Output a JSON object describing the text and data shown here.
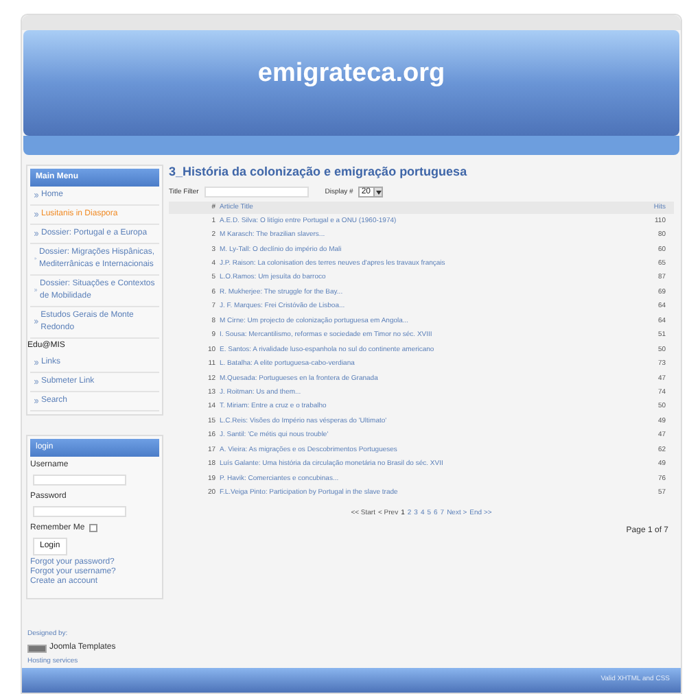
{
  "site_title": "emigrateca.org",
  "main_menu": {
    "title": "Main Menu",
    "items": [
      {
        "label": "Home",
        "kind": "link",
        "selected": false
      },
      {
        "label": "Lusitanis in Diaspora",
        "kind": "link",
        "selected": true
      },
      {
        "label": "Dossier: Portugal e a Europa",
        "kind": "link",
        "selected": false
      },
      {
        "label": "Dossier: Migrações Hispânicas, Mediterrânicas e Internacionais",
        "kind": "link",
        "selected": false
      },
      {
        "label": "Dossier: Situações e Contextos de Mobilidade",
        "kind": "link",
        "selected": false
      },
      {
        "label": "Estudos Gerais de Monte Redondo",
        "kind": "link",
        "selected": false
      },
      {
        "label": "Edu@MIS",
        "kind": "heading"
      },
      {
        "label": "Links",
        "kind": "link",
        "selected": false
      },
      {
        "label": "Submeter Link",
        "kind": "link",
        "selected": false
      },
      {
        "label": "Search",
        "kind": "link",
        "selected": false
      }
    ]
  },
  "login": {
    "title": "login",
    "username_label": "Username",
    "password_label": "Password",
    "remember_label": "Remember Me",
    "remember_checked": false,
    "button": "Login",
    "links": [
      "Forgot your password?",
      "Forgot your username?",
      "Create an account"
    ]
  },
  "credits": {
    "designed_by": "Designed by:",
    "templates": "Joomla Templates",
    "hosting": "Hosting services"
  },
  "content": {
    "heading": "3_História da colonização e emigração portuguesa",
    "filter_label": "Title Filter",
    "display_label": "Display #",
    "display_value": "20",
    "columns": [
      "#",
      "Article Title",
      "Hits"
    ],
    "rows": [
      [
        "1",
        "A.E.D. Silva: O litígio entre Portugal e a ONU (1960-1974)",
        "110"
      ],
      [
        "2",
        "M Karasch: The brazilian slavers...",
        "80"
      ],
      [
        "3",
        "M. Ly-Tall: O declínio do império do Mali",
        "60"
      ],
      [
        "4",
        "J.P. Raison: La colonisation des terres neuves d'apres les travaux français",
        "65"
      ],
      [
        "5",
        "L.O.Ramos: Um jesuíta do barroco",
        "87"
      ],
      [
        "6",
        "R. Mukherjee: The struggle for the Bay...",
        "69"
      ],
      [
        "7",
        "J. F. Marques: Frei Cristóvão de Lisboa...",
        "64"
      ],
      [
        "8",
        "M Cirne: Um projecto de colonização portuguesa em Angola...",
        "64"
      ],
      [
        "9",
        "I. Sousa: Mercantilismo, reformas e sociedade em Timor no séc. XVIII",
        "51"
      ],
      [
        "10",
        "E. Santos: A rivalidade luso-espanhola no sul do continente americano",
        "50"
      ],
      [
        "11",
        "L. Batalha: A elite portuguesa-cabo-verdiana",
        "73"
      ],
      [
        "12",
        "M.Quesada: Portugueses en la frontera de Granada",
        "47"
      ],
      [
        "13",
        "J. Roitman: Us and them...",
        "74"
      ],
      [
        "14",
        "T. Miriam: Entre a cruz e o trabalho",
        "50"
      ],
      [
        "15",
        "L.C.Reis: Visões do Império nas vésperas do 'Ultimato'",
        "49"
      ],
      [
        "16",
        "J. Santil: 'Ce métis qui nous trouble'",
        "47"
      ],
      [
        "17",
        "A. Vieira: As migrações e os Descobrimentos Portugueses",
        "62"
      ],
      [
        "18",
        "Luís Galante: Uma história da circulação monetária no Brasil do séc. XVII",
        "49"
      ],
      [
        "19",
        "P. Havik: Comerciantes e concubinas...",
        "76"
      ],
      [
        "20",
        "F.L.Veiga Pinto: Participation by Portugal in the slave trade",
        "57"
      ]
    ],
    "pagination": [
      {
        "label": "<< Start",
        "kind": "disabled"
      },
      {
        "label": "< Prev",
        "kind": "disabled"
      },
      {
        "label": "1",
        "kind": "current"
      },
      {
        "label": "2",
        "kind": "link"
      },
      {
        "label": "3",
        "kind": "link"
      },
      {
        "label": "4",
        "kind": "link"
      },
      {
        "label": "5",
        "kind": "link"
      },
      {
        "label": "6",
        "kind": "link"
      },
      {
        "label": "7",
        "kind": "link"
      },
      {
        "label": "Next >",
        "kind": "link"
      },
      {
        "label": "End >>",
        "kind": "link"
      }
    ],
    "page_counter": "Page 1 of 7"
  },
  "footer": "Valid XHTML and CSS"
}
